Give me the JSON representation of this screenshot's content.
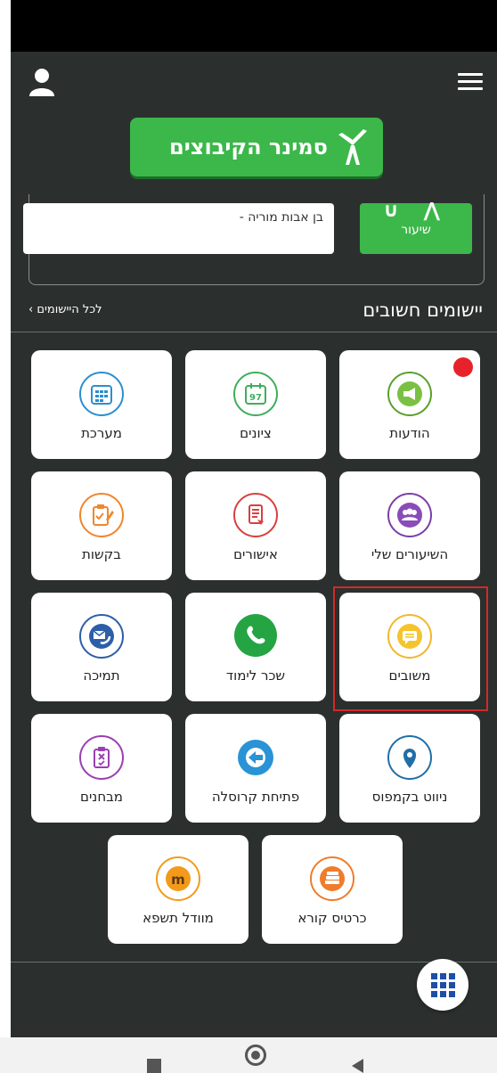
{
  "logo": {
    "text": "סמינר הקיבוצים"
  },
  "lesson": {
    "text": "בן אבות מוריה -",
    "button_label": "שיעור"
  },
  "apps": {
    "title": "יישומים חשובים",
    "all_link": "לכל היישומים ›",
    "tiles": [
      {
        "label": "הודעות",
        "icon": "megaphone-icon",
        "color": "#5aa02c",
        "has_notification": true
      },
      {
        "label": "ציונים",
        "icon": "calendar-97-icon",
        "color": "#3fae5a",
        "icon_text": "97"
      },
      {
        "label": "מערכת",
        "icon": "schedule-icon",
        "color": "#2b8fcf"
      },
      {
        "label": "השיעורים שלי",
        "icon": "group-icon",
        "color": "#7a3fa8"
      },
      {
        "label": "אישורים",
        "icon": "document-icon",
        "color": "#d9403f"
      },
      {
        "label": "בקשות",
        "icon": "clipboard-edit-icon",
        "color": "#f0862d"
      },
      {
        "label": "משובים",
        "icon": "chat-bubble-icon",
        "color": "#f1b72b"
      },
      {
        "label": "שכר לימוד",
        "icon": "whatsapp-icon",
        "color": "#25a443"
      },
      {
        "label": "תמיכה",
        "icon": "support-mail-icon",
        "color": "#2c5fa8"
      },
      {
        "label": "ניווט בקמפוס",
        "icon": "map-pin-icon",
        "color": "#1f6fa8"
      },
      {
        "label": "פתיחת קרוסלה",
        "icon": "carousel-arrow-icon",
        "color": "#2993d6"
      },
      {
        "label": "מבחנים",
        "icon": "exam-clipboard-icon",
        "color": "#9a3fb3"
      },
      {
        "label": "כרטיס קורא",
        "icon": "books-icon",
        "color": "#ef7c2c"
      },
      {
        "label": "מוודל תשפא",
        "icon": "moodle-icon",
        "color": "#f39a1b"
      }
    ]
  },
  "colors": {
    "app_bg": "#2b302f",
    "accent_green": "#3cb74a",
    "highlight": "#d12a2a",
    "fab_icon": "#1e4ea5"
  }
}
